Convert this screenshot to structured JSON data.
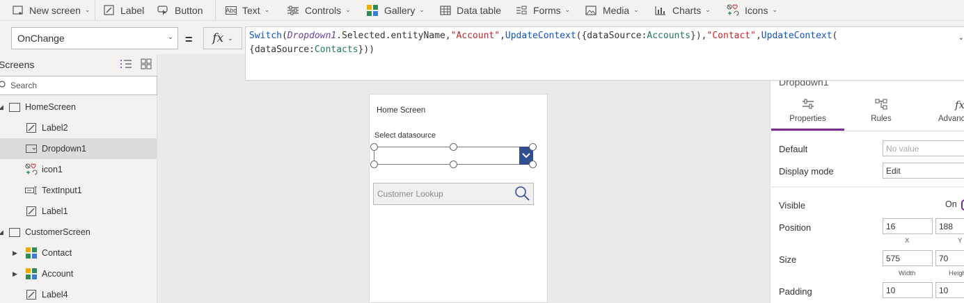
{
  "ribbon": {
    "new_screen": "New screen",
    "label": "Label",
    "button": "Button",
    "text": "Text",
    "controls": "Controls",
    "gallery": "Gallery",
    "data_table": "Data table",
    "forms": "Forms",
    "media": "Media",
    "charts": "Charts",
    "icons": "Icons"
  },
  "formula_bar": {
    "property": "OnChange",
    "equals": "=",
    "fx": "fx",
    "tokens": [
      {
        "k": "f",
        "t": "Switch"
      },
      {
        "k": "p",
        "t": "("
      },
      {
        "k": "c",
        "t": "Dropdown1"
      },
      {
        "k": "p",
        "t": ".Selected.entityName,"
      },
      {
        "k": "s",
        "t": "\"Account\""
      },
      {
        "k": "p",
        "t": ","
      },
      {
        "k": "f",
        "t": "UpdateContext"
      },
      {
        "k": "p",
        "t": "({dataSource:"
      },
      {
        "k": "t",
        "t": "Accounts"
      },
      {
        "k": "p",
        "t": "}),"
      },
      {
        "k": "s",
        "t": "\"Contact\""
      },
      {
        "k": "p",
        "t": ","
      },
      {
        "k": "f",
        "t": "UpdateContext"
      },
      {
        "k": "p",
        "t": "("
      }
    ],
    "tokens_line2": [
      {
        "k": "p",
        "t": "{dataSource:"
      },
      {
        "k": "t",
        "t": "Contacts"
      },
      {
        "k": "p",
        "t": "}))"
      }
    ]
  },
  "tree": {
    "title": "Screens",
    "search_placeholder": "Search",
    "nodes": [
      {
        "label": "HomeScreen",
        "icon": "screen-icon",
        "level": 0,
        "caret": "◢"
      },
      {
        "label": "Label2",
        "icon": "label-icon",
        "level": 1
      },
      {
        "label": "Dropdown1",
        "icon": "dropdown-icon",
        "level": 1,
        "selected": true
      },
      {
        "label": "icon1",
        "icon": "icons-icon",
        "level": 1
      },
      {
        "label": "TextInput1",
        "icon": "textinput-icon",
        "level": 1
      },
      {
        "label": "Label1",
        "icon": "label-icon",
        "level": 1
      },
      {
        "label": "CustomerScreen",
        "icon": "screen-icon",
        "level": 0,
        "caret": "◢"
      },
      {
        "label": "Contact",
        "icon": "gallery-icon",
        "level": 1,
        "caret": "▶"
      },
      {
        "label": "Account",
        "icon": "gallery-icon",
        "level": 1,
        "caret": "▶"
      },
      {
        "label": "Label4",
        "icon": "label-icon",
        "level": 1
      }
    ]
  },
  "canvas": {
    "screen_title": "Home Screen",
    "select_label": "Select datasource",
    "lookup_placeholder": "Customer Lookup"
  },
  "props": {
    "control_name": "Dropdown1",
    "tabs": [
      "Properties",
      "Rules",
      "Advanced"
    ],
    "default_label": "Default",
    "default_placeholder": "No value",
    "display_mode_label": "Display mode",
    "display_mode_value": "Edit",
    "visible_label": "Visible",
    "visible_value": "On",
    "position_label": "Position",
    "position_x": "16",
    "position_y": "188",
    "x_cap": "X",
    "y_cap": "Y",
    "size_label": "Size",
    "size_w": "575",
    "size_h": "70",
    "width_cap": "Width",
    "height_cap": "Height",
    "padding_label": "Padding",
    "padding_1": "10",
    "padding_2": "10"
  },
  "colors": {
    "accent": "#7b2a92",
    "dropdown_button": "#2f4f8f",
    "selected_row": "#dcdcdc"
  }
}
